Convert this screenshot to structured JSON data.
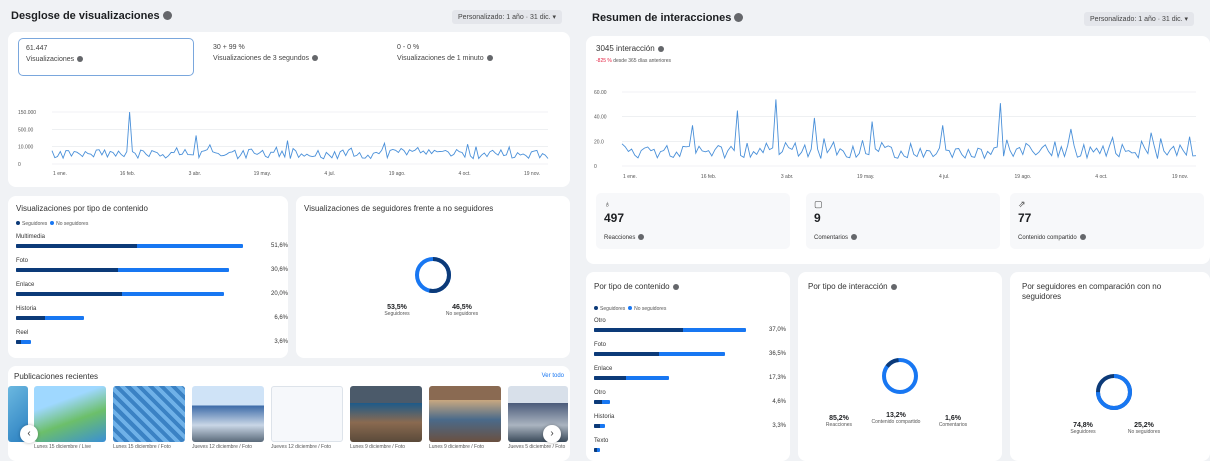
{
  "left_panel": {
    "title": "Desglose de visualizaciones",
    "dropdown": "Personalizado: 1 año · 31 dic. ▾",
    "metrics": [
      {
        "value": "61.447",
        "label": "Visualizaciones"
      },
      {
        "value": "30 + 99 %",
        "label": "Visualizaciones de 3 segundos"
      },
      {
        "value": "0 - 0 %",
        "label": "Visualizaciones de 1 minuto"
      }
    ],
    "chart_y_ticks": [
      "150.000",
      "500.00",
      "10.000",
      "0"
    ],
    "chart_x_ticks": [
      "1 ene.",
      "16 feb.",
      "3 abr.",
      "19 may.",
      "4 jul.",
      "19 ago.",
      "4 oct.",
      "19 nov."
    ],
    "content_type": {
      "title": "Visualizaciones por tipo de contenido",
      "legend": [
        "Seguidores",
        "No seguidores"
      ],
      "rows": [
        {
          "label": "Multimedia",
          "pct": "51,6%",
          "total": 0.94,
          "followers": 0.5
        },
        {
          "label": "Foto",
          "pct": "30,6%",
          "total": 0.88,
          "followers": 0.42
        },
        {
          "label": "Enlace",
          "pct": "20,0%",
          "total": 0.86,
          "followers": 0.44
        },
        {
          "label": "Historia",
          "pct": "6,6%",
          "total": 0.28,
          "followers": 0.12
        },
        {
          "label": "Reel",
          "pct": "3,6%",
          "total": 0.06,
          "followers": 0.02
        }
      ]
    },
    "followers_split": {
      "title": "Visualizaciones de seguidores frente a no seguidores",
      "values": [
        {
          "pct": "53,5%",
          "name": "Seguidores",
          "fraction": 0.535
        },
        {
          "pct": "46,5%",
          "name": "No seguidores",
          "fraction": 0.465
        }
      ]
    },
    "recent": {
      "title": "Publicaciones recientes",
      "link": "Ver todo",
      "captions": [
        "Lunes 15 diciembre / Live",
        "Lunes 15 diciembre / Foto",
        "Jueves 12 diciembre / Foto",
        "Jueves 12 diciembre / Foto",
        "Lunes 9 diciembre / Foto",
        "Lunes 9 diciembre / Foto",
        "Jueves 5 diciembre / Foto"
      ]
    }
  },
  "right_panel": {
    "title": "Resumen de interacciones",
    "dropdown": "Personalizado: 1 año · 31 dic. ▾",
    "headline": "3045 interacción",
    "delta": "-825 %",
    "delta_note": "desde 365 días anteriores",
    "chart_y_ticks": [
      "60.00",
      "40.00",
      "20.0",
      "0"
    ],
    "chart_x_ticks": [
      "1 ene.",
      "16 feb.",
      "3 abr.",
      "19 may.",
      "4 jul.",
      "19 ago.",
      "4 oct.",
      "19 nov."
    ],
    "stats": [
      {
        "icon": "thumbs-up-icon",
        "value": "497",
        "label": "Reacciones"
      },
      {
        "icon": "comment-icon",
        "value": "9",
        "label": "Comentarios"
      },
      {
        "icon": "share-icon",
        "value": "77",
        "label": "Contenido compartido"
      }
    ],
    "content_type": {
      "title": "Por tipo de contenido",
      "legend": [
        "Seguidores",
        "No seguidores"
      ],
      "rows": [
        {
          "label": "Otro",
          "pct": "37,0%",
          "total": 0.94,
          "followers": 0.55
        },
        {
          "label": "Foto",
          "pct": "36,5%",
          "total": 0.81,
          "followers": 0.4
        },
        {
          "label": "Enlace",
          "pct": "17,3%",
          "total": 0.46,
          "followers": 0.2
        },
        {
          "label": "Otro",
          "pct": "4,6%",
          "total": 0.1,
          "followers": 0.05
        },
        {
          "label": "Historia",
          "pct": "3,3%",
          "total": 0.07,
          "followers": 0.04
        },
        {
          "label": "Texto",
          "pct": "",
          "total": 0.04,
          "followers": 0.02
        }
      ]
    },
    "interaction_type": {
      "title": "Por tipo de interacción",
      "values": [
        {
          "pct": "85,2%",
          "name": "Reacciones"
        },
        {
          "pct": "13,2%",
          "name": "Contenido compartido"
        },
        {
          "pct": "1,6%",
          "name": "Comentarios"
        }
      ]
    },
    "followers_split": {
      "title": "Por seguidores en comparación con no seguidores",
      "values": [
        {
          "pct": "74,8%",
          "name": "Seguidores",
          "fraction": 0.748
        },
        {
          "pct": "25,2%",
          "name": "No seguidores",
          "fraction": 0.252
        }
      ]
    }
  },
  "colors": {
    "primary": "#1877f2",
    "dark": "#0c3a78",
    "line": "#4a90d9"
  }
}
